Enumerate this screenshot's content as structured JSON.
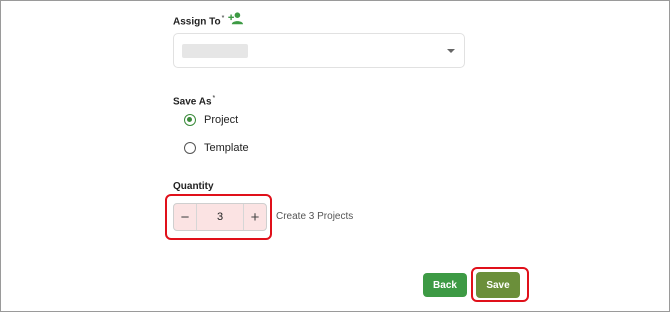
{
  "assign_to": {
    "label": "Assign To",
    "required_mark": "*",
    "add_user_icon": "person-add-icon"
  },
  "save_as": {
    "label": "Save As",
    "required_mark": "*",
    "options": [
      {
        "label": "Project",
        "selected": true
      },
      {
        "label": "Template",
        "selected": false
      }
    ]
  },
  "quantity": {
    "label": "Quantity",
    "value": "3",
    "decrement": "−",
    "increment": "+",
    "hint": "Create 3 Projects"
  },
  "actions": {
    "back_label": "Back",
    "save_label": "Save"
  },
  "colors": {
    "accent_green": "#3d9a44",
    "save_green": "#6b8f3a",
    "highlight_red": "#e0101a",
    "stepper_bg": "#fbe3e3"
  }
}
